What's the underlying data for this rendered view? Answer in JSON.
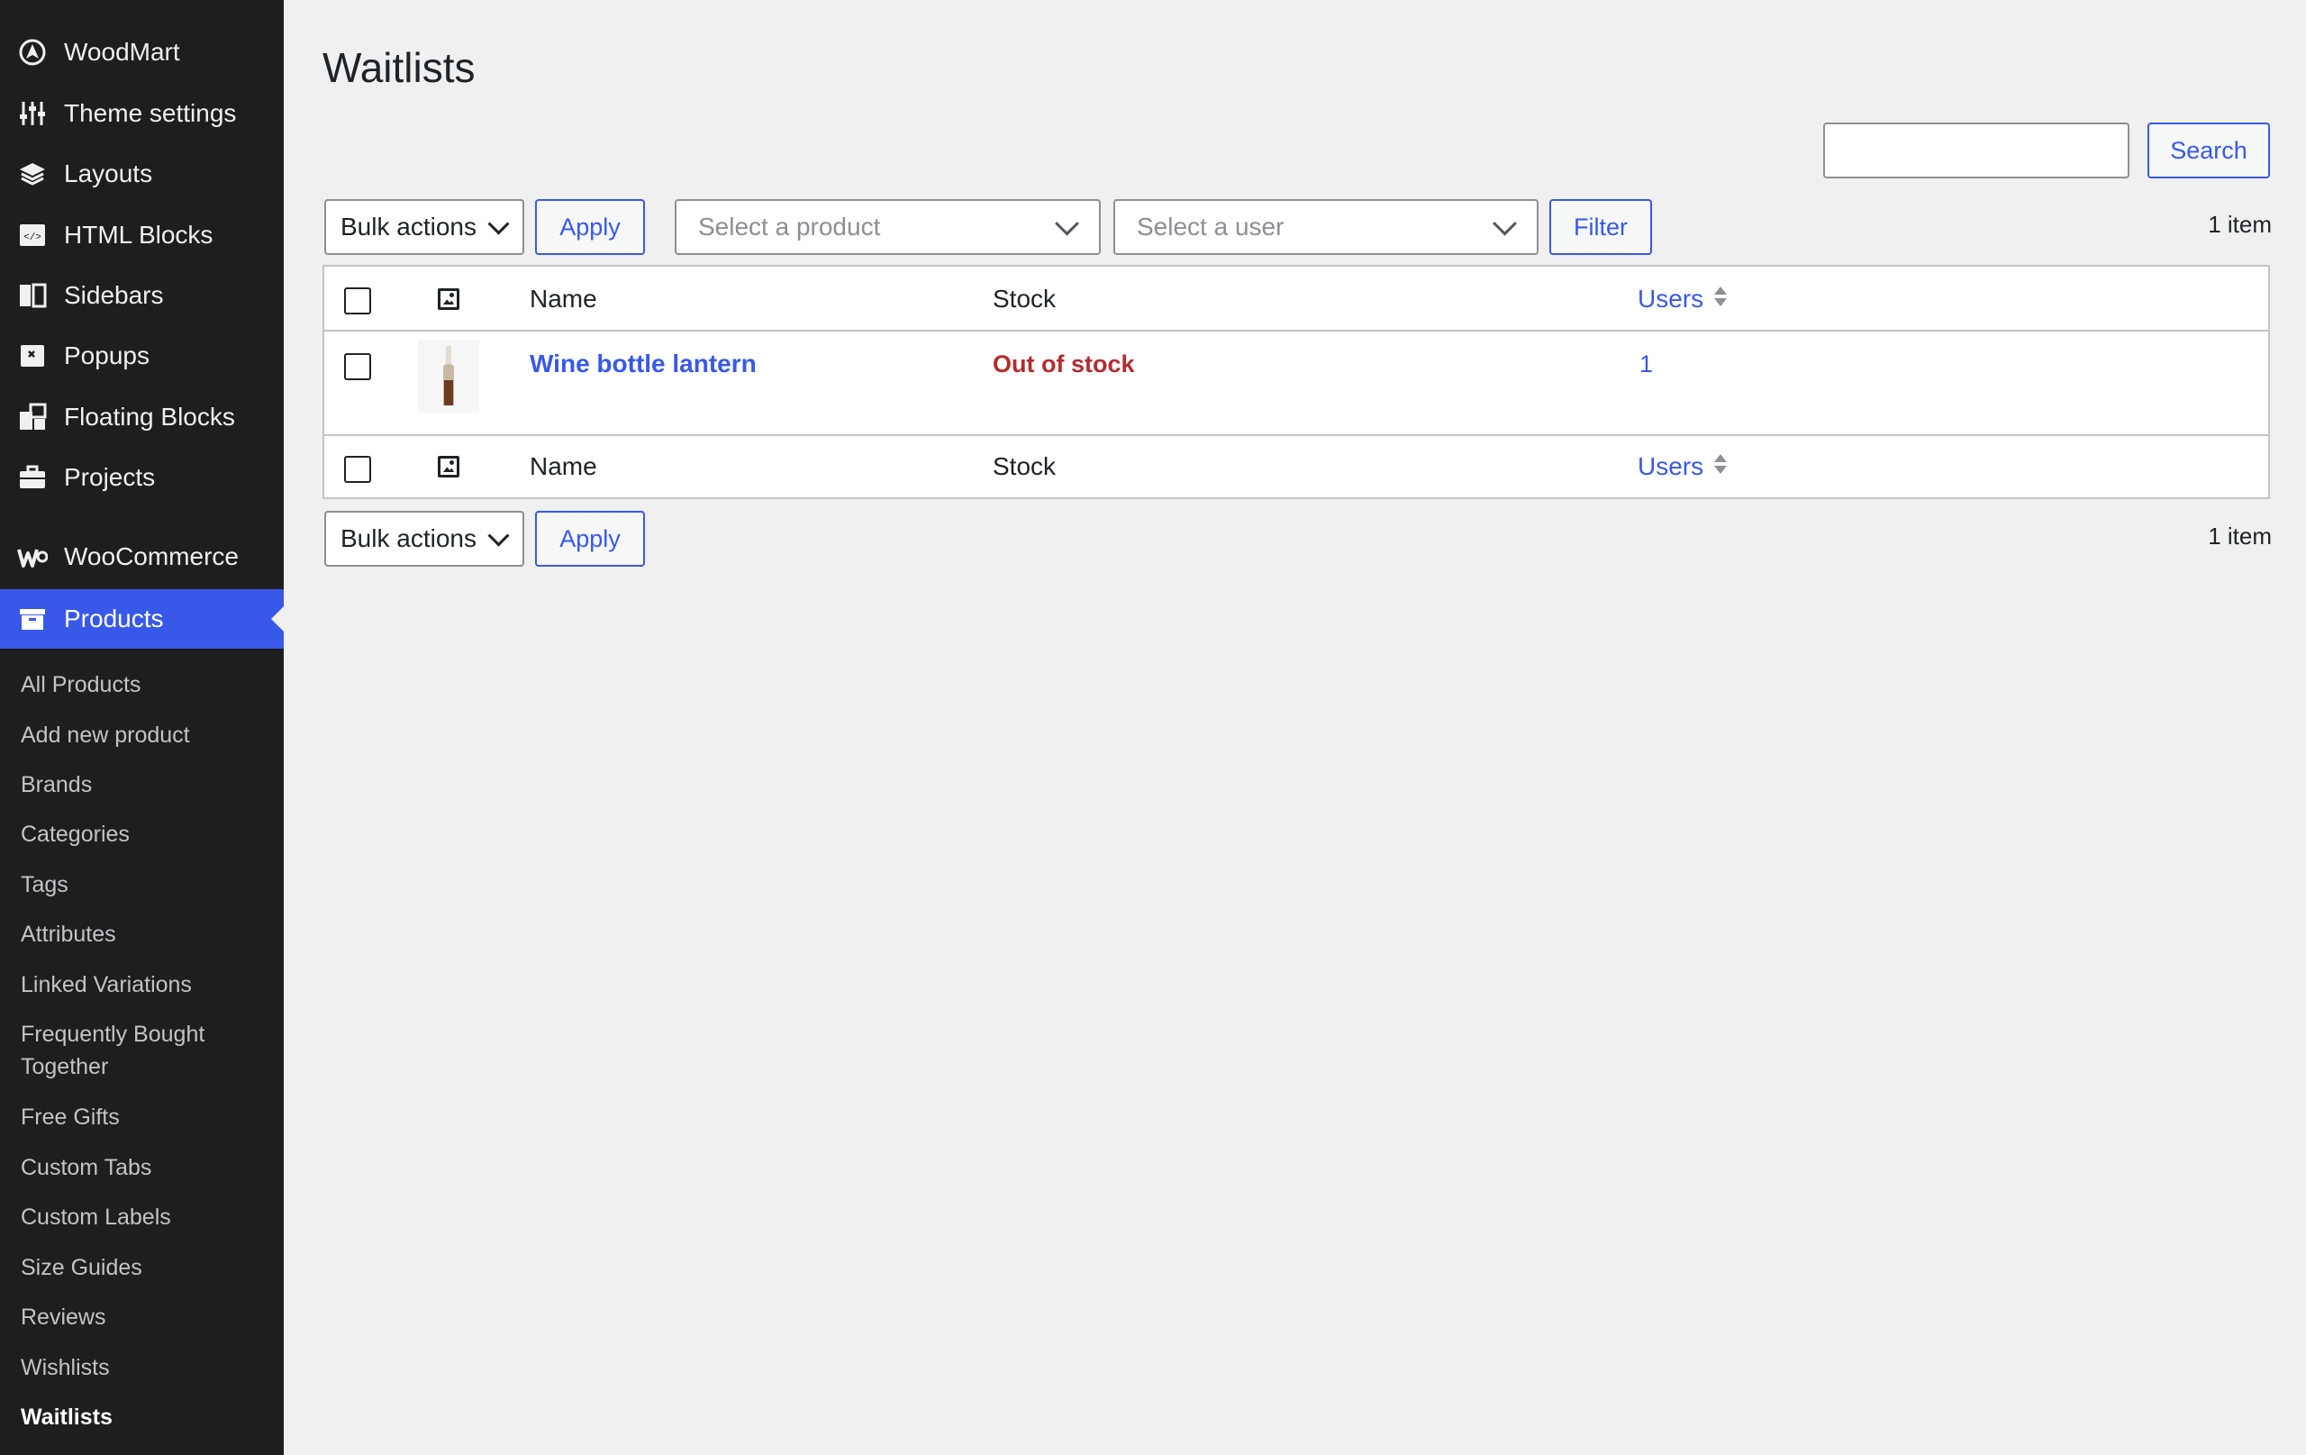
{
  "sidebar": {
    "top_items": [
      {
        "label": "WoodMart",
        "icon": "woodmart-logo-icon"
      },
      {
        "label": "Theme settings",
        "icon": "sliders-icon"
      },
      {
        "label": "Layouts",
        "icon": "layers-icon"
      },
      {
        "label": "HTML Blocks",
        "icon": "code-block-icon"
      },
      {
        "label": "Sidebars",
        "icon": "sidebar-icon"
      },
      {
        "label": "Popups",
        "icon": "popup-icon"
      },
      {
        "label": "Floating Blocks",
        "icon": "floating-blocks-icon"
      },
      {
        "label": "Projects",
        "icon": "briefcase-icon"
      },
      {
        "label": "WooCommerce",
        "icon": "woocommerce-icon"
      },
      {
        "label": "Products",
        "icon": "archive-icon"
      }
    ],
    "submenu": [
      "All Products",
      "Add new product",
      "Brands",
      "Categories",
      "Tags",
      "Attributes",
      "Linked Variations",
      "Frequently Bought",
      "Together",
      "Free Gifts",
      "Custom Tabs",
      "Custom Labels",
      "Size Guides",
      "Reviews",
      "Wishlists",
      "Waitlists"
    ],
    "colors": {
      "background": "#1e1e1e",
      "active": "#3858e9"
    }
  },
  "page": {
    "title": "Waitlists",
    "search_button": "Search",
    "search_value": ""
  },
  "toolbar_top": {
    "bulk_actions": "Bulk actions",
    "apply": "Apply",
    "product_select_placeholder": "Select a product",
    "user_select_placeholder": "Select a user",
    "filter": "Filter",
    "count": "1 item"
  },
  "table": {
    "headers": {
      "name": "Name",
      "stock": "Stock",
      "users": "Users"
    },
    "rows": [
      {
        "name": "Wine bottle lantern",
        "stock": "Out of stock",
        "users": "1"
      }
    ]
  },
  "toolbar_bottom": {
    "bulk_actions": "Bulk actions",
    "apply": "Apply",
    "count": "1 item"
  },
  "accent_color": "#3858e9",
  "out_of_stock_color": "#b32d2e"
}
